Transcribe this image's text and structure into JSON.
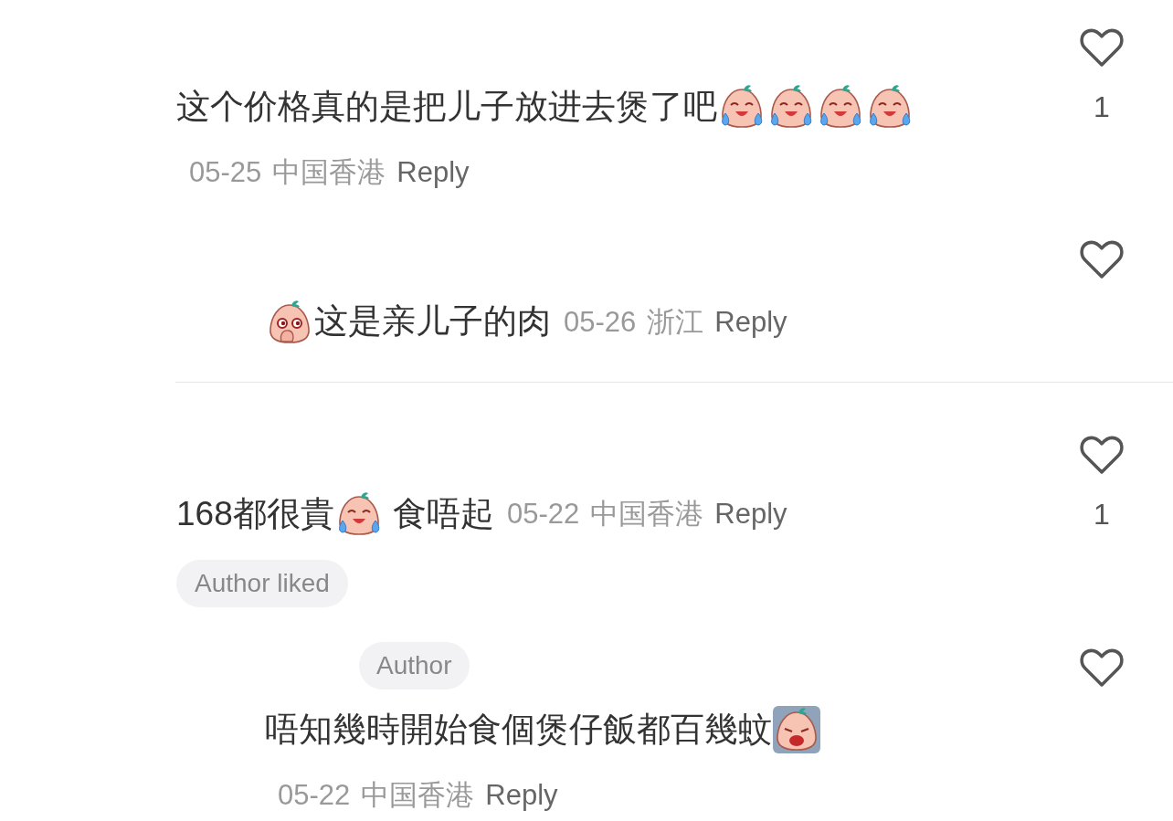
{
  "threads": [
    {
      "comment": {
        "content": [
          {
            "kind": "text",
            "text": "这个价格真的是把儿子放进去煲了吧"
          },
          {
            "kind": "tears"
          },
          {
            "kind": "tears"
          },
          {
            "kind": "tears"
          },
          {
            "kind": "tears"
          }
        ],
        "date": "05-25",
        "location": "中国香港",
        "reply": "Reply",
        "liked": false,
        "likes": "1"
      },
      "replies": [
        {
          "content": [
            {
              "kind": "peek"
            },
            {
              "kind": "text",
              "text": "这是亲儿子的肉"
            }
          ],
          "date": "05-26",
          "location": "浙江",
          "reply": "Reply",
          "liked": false
        }
      ]
    },
    {
      "comment": {
        "content": [
          {
            "kind": "text",
            "text": "168都很貴"
          },
          {
            "kind": "tears"
          },
          {
            "kind": "text",
            "text": " 食唔起"
          }
        ],
        "date": "05-22",
        "location": "中国香港",
        "reply": "Reply",
        "liked": false,
        "likes": "1",
        "badge": "Author liked"
      },
      "replies": [
        {
          "tag": "Author",
          "content": [
            {
              "kind": "text",
              "text": "唔知幾時開始食個煲仔飯都百幾蚊"
            },
            {
              "kind": "wail"
            }
          ],
          "date": "05-22",
          "location": "中国香港",
          "reply": "Reply",
          "liked": false
        }
      ]
    }
  ]
}
